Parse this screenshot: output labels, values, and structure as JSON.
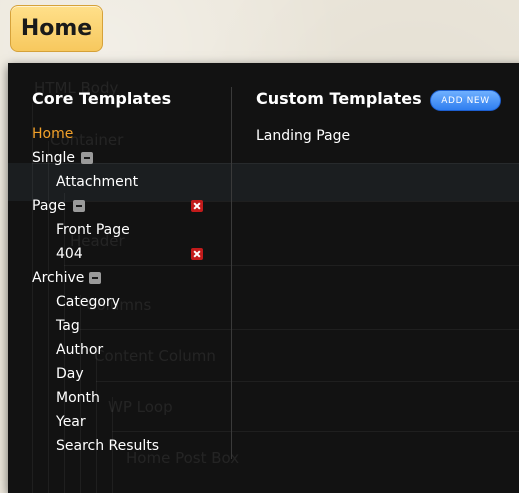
{
  "home_button": {
    "label": "Home"
  },
  "background": {
    "labels": [
      "HTML Body",
      "Container",
      "Header",
      "Columns",
      "Content Column",
      "WP Loop",
      "Home Post Box"
    ]
  },
  "core": {
    "title": "Core Templates",
    "items": [
      {
        "label": "Home",
        "active": true
      },
      {
        "label": "Single",
        "collapse": true
      },
      {
        "label": "Attachment"
      },
      {
        "label": "Page",
        "collapse": true,
        "delete": true
      },
      {
        "label": "Front Page"
      },
      {
        "label": "404",
        "delete": true
      },
      {
        "label": "Archive",
        "collapse": true
      },
      {
        "label": "Category"
      },
      {
        "label": "Tag"
      },
      {
        "label": "Author"
      },
      {
        "label": "Day"
      },
      {
        "label": "Month"
      },
      {
        "label": "Year"
      },
      {
        "label": "Search Results"
      }
    ]
  },
  "custom": {
    "title": "Custom Templates",
    "add_new": "ADD NEW",
    "items": [
      {
        "label": "Landing Page"
      }
    ]
  },
  "colors": {
    "panel_bg": "#121212",
    "active_item": "#f2a12a",
    "home_button": "#f7c85e",
    "delete": "#c21b1b",
    "add_new": "#2f7ef0"
  }
}
